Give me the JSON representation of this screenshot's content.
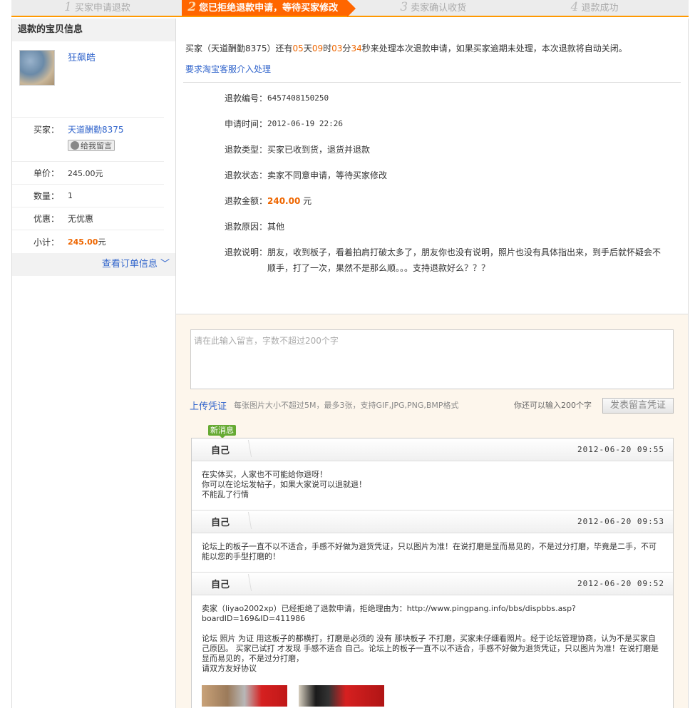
{
  "steps": [
    {
      "num": "1",
      "label": "买家申请退款",
      "active": false
    },
    {
      "num": "2",
      "label": "您已拒绝退款申请，等待买家修改",
      "active": true
    },
    {
      "num": "3",
      "label": "卖家确认收货",
      "active": false
    },
    {
      "num": "4",
      "label": "退款成功",
      "active": false
    }
  ],
  "left": {
    "title": "退款的宝贝信息",
    "product_name": "狂飙皓",
    "buyer_label": "买家：",
    "buyer_name": "天道酬勤8375",
    "leave_msg": "给我留言",
    "price_label": "单价：",
    "price": "245.00元",
    "qty_label": "数量：",
    "qty": "1",
    "discount_label": "优惠：",
    "discount": "无优惠",
    "subtotal_label": "小计：",
    "subtotal": "245.00",
    "subtotal_unit": "元",
    "view_order": "查看订单信息"
  },
  "notice": {
    "pre": "买家（天道酬勤8375）还有",
    "d": "05",
    "d_u": "天",
    "h": "09",
    "h_u": "时",
    "m": "03",
    "m_u": "分",
    "s": "34",
    "post": "秒来处理本次退款申请，如果买家逾期未处理，本次退款将自动关闭。",
    "cs_link": "要求淘宝客服介入处理"
  },
  "info": {
    "id_k": "退款编号：",
    "id_v": "6457408150250",
    "time_k": "申请时间：",
    "time_v": "2012-06-19 22:26",
    "type_k": "退款类型：",
    "type_v": "买家已收到货，退货并退款",
    "status_k": "退款状态：",
    "status_v": "卖家不同意申请，等待买家修改",
    "amount_k": "退款金额：",
    "amount_v": "240.00",
    "amount_u": " 元",
    "reason_k": "退款原因：",
    "reason_v": "其他",
    "desc_k": "退款说明：",
    "desc_v": "朋友，收到板子，看着拍肩打破太多了，朋友你也没有说明，照片也没有具体指出来，到手后就怀疑会不顺手，打了一次，果然不是那么顺。。。支持退款好么？？？"
  },
  "compose": {
    "placeholder": "请在此输入留言，字数不超过200个字",
    "upload": "上传凭证",
    "upload_hint": "每张图片大小不超过5M，最多3张，支持GIF,JPG,PNG,BMP格式",
    "remain": "你还可以输入200个字",
    "send": "发表留言凭证",
    "new_badge": "新消息"
  },
  "messages": [
    {
      "who": "自己",
      "time": "2012-06-20  09:55",
      "body": "在实体买，人家也不可能给你退呀！\n你可以在论坛发帖子，如果大家说可以退就退！\n不能乱了行情"
    },
    {
      "who": "自己",
      "time": "2012-06-20  09:53",
      "body": "论坛上的板子一直不以不适合，手感不好做为退货凭证，只以图片为准！在说打磨是显而易见的，不是过分打磨，毕竟是二手，不可能以您的手型打磨的！"
    },
    {
      "who": "自己",
      "time": "2012-06-20  09:52",
      "body": "卖家（liyao2002xp）已经拒绝了退款申请，拒绝理由为：http://www.pingpang.info/bbs/dispbbs.asp?boardID=169&ID=411986\n\n论坛 照片 为证 用这板子的都横打，打磨是必须的 没有 那块板子 不打磨，买家未仔细看照片。经于论坛管理协商，认为不是买家自己原因。 买家已试打 才发现 手感不适合 自己。论坛上的板子一直不以不适合，手感不好做为退货凭证，只以图片为准！在说打磨是显而易见的，不是过分打磨，\n请双方友好协议"
    }
  ]
}
